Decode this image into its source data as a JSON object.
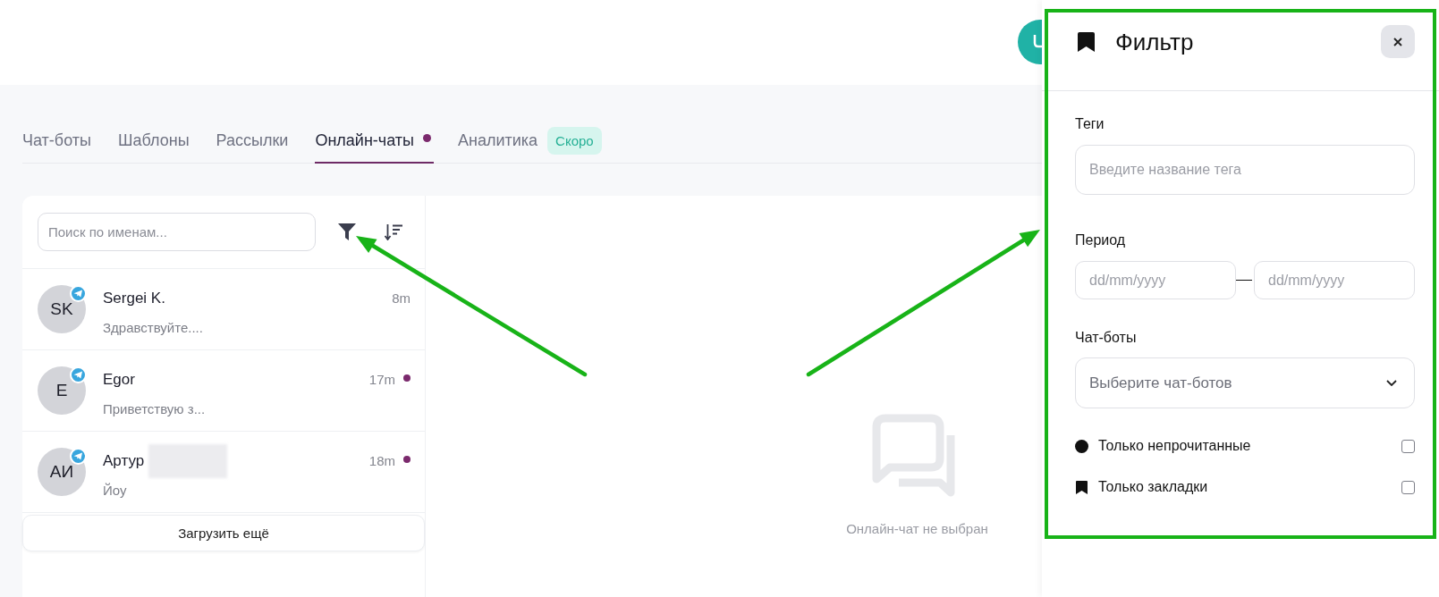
{
  "tabs": [
    {
      "label": "Чат-боты",
      "selected": false,
      "notify": false
    },
    {
      "label": "Шаблоны",
      "selected": false,
      "notify": false
    },
    {
      "label": "Рассылки",
      "selected": false,
      "notify": false
    },
    {
      "label": "Онлайн-чаты",
      "selected": true,
      "notify": true
    },
    {
      "label": "Аналитика",
      "selected": false,
      "notify": false,
      "badge": "Скоро"
    }
  ],
  "chat_list": {
    "search": {
      "placeholder": "Поиск по именам..."
    },
    "chats": [
      {
        "initials": "SK",
        "name": "Sergei K.",
        "redacted": false,
        "preview": "Здравствуйте....",
        "time": "8m",
        "unread": false
      },
      {
        "initials": "E",
        "name": "Egor",
        "redacted": false,
        "preview": "Приветствую з...",
        "time": "17m",
        "unread": true
      },
      {
        "initials": "АИ",
        "name": "Артур",
        "redacted": true,
        "preview": "Йоу",
        "time": "18m",
        "unread": true
      }
    ],
    "load_more": "Загрузить ещё"
  },
  "chat_view": {
    "empty_text": "Онлайн-чат не выбран"
  },
  "filter_panel": {
    "title": "Фильтр",
    "tags": {
      "label": "Теги",
      "placeholder": "Введите название тега"
    },
    "period": {
      "label": "Период",
      "from": {
        "placeholder": "dd/mm/yyyy"
      },
      "to": {
        "placeholder": "dd/mm/yyyy"
      }
    },
    "chatbots": {
      "label": "Чат-боты",
      "placeholder": "Выберите чат-ботов"
    },
    "options": [
      {
        "kind": "unread",
        "label": "Только непрочитанные",
        "checked": false
      },
      {
        "kind": "bookmarks",
        "label": "Только закладки",
        "checked": false
      }
    ]
  }
}
